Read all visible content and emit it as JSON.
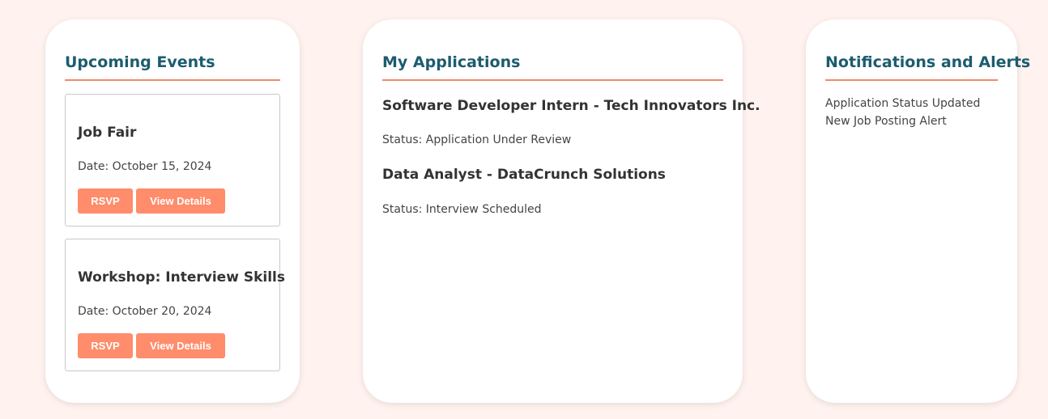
{
  "events": {
    "title": "Upcoming Events",
    "items": [
      {
        "name": "Job Fair",
        "date": "Date: October 15, 2024",
        "rsvp_label": "RSVP",
        "details_label": "View Details"
      },
      {
        "name": "Workshop: Interview Skills",
        "date": "Date: October 20, 2024",
        "rsvp_label": "RSVP",
        "details_label": "View Details"
      }
    ]
  },
  "applications": {
    "title": "My Applications",
    "items": [
      {
        "title": "Software Developer Intern - Tech Innovators Inc.",
        "status": "Status: Application Under Review"
      },
      {
        "title": "Data Analyst - DataCrunch Solutions",
        "status": "Status: Interview Scheduled"
      }
    ]
  },
  "notifications": {
    "title": "Notifications and Alerts",
    "items": [
      "Application Status Updated",
      "New Job Posting Alert"
    ]
  },
  "colors": {
    "background": "#fff2ef",
    "heading": "#1c5c6f",
    "accent": "#f08a6c",
    "button": "#ff8c6b"
  }
}
